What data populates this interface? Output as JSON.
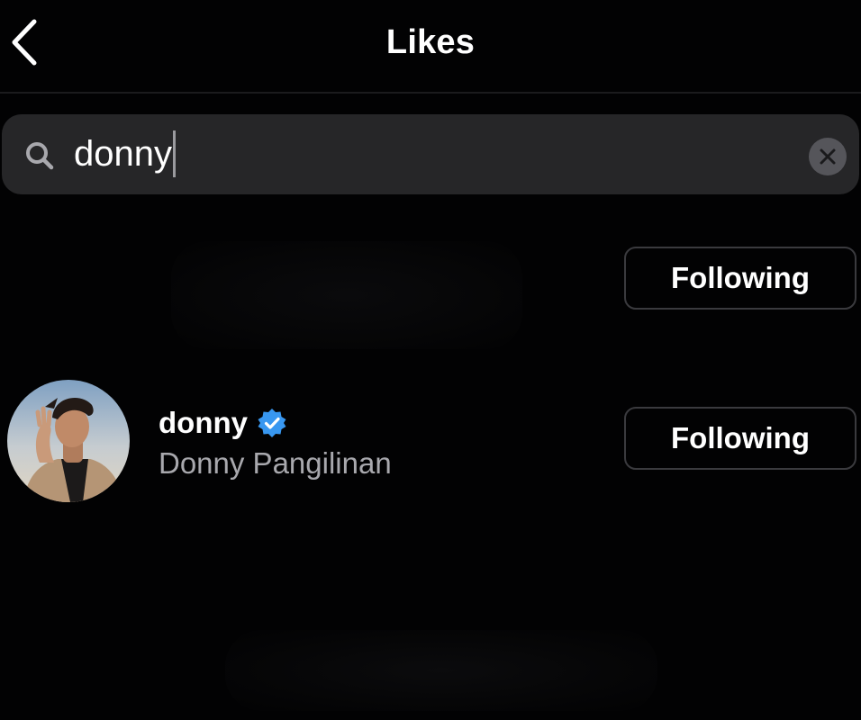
{
  "header": {
    "title": "Likes",
    "back_icon": "chevron-left-icon"
  },
  "search": {
    "value": "donny",
    "icon": "search-icon",
    "clear_icon": "close-circle-icon"
  },
  "results": [
    {
      "username": "",
      "full_name": "",
      "follow_label": "Following",
      "blurred": true
    },
    {
      "username": "donny",
      "verified": true,
      "full_name": "Donny Pangilinan",
      "follow_label": "Following"
    }
  ],
  "colors": {
    "background": "#020203",
    "search_bg": "#262628",
    "verified_blue": "#3897f0",
    "secondary_text": "#a8a8ad",
    "button_border": "#3a3a3e"
  }
}
